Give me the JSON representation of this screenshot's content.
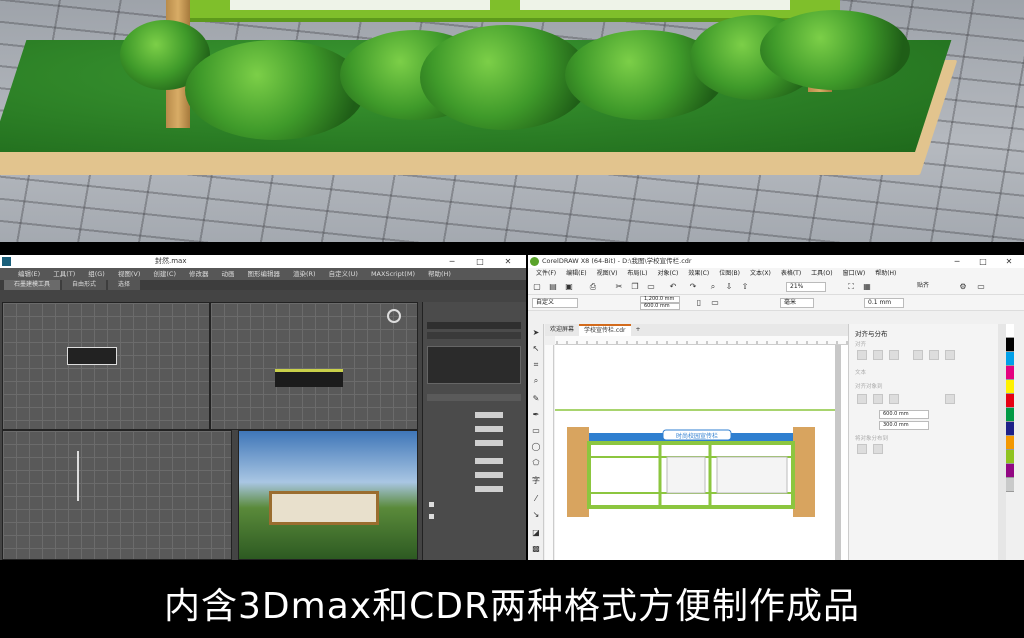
{
  "caption": "内含3Dmax和CDR两种格式方便制作成品",
  "max_window": {
    "title": "封然.max",
    "menu": [
      "编辑(E)",
      "工具(T)",
      "组(G)",
      "视图(V)",
      "创建(C)",
      "修改器",
      "动画",
      "图形编辑器",
      "渲染(R)",
      "自定义(U)",
      "MAXScript(M)",
      "帮助(H)"
    ],
    "ribbon_tabs": [
      "石墨建模工具",
      "自由形式",
      "选择"
    ],
    "controls": {
      "minimize": "─",
      "maximize": "□",
      "close": "✕"
    }
  },
  "cdr_window": {
    "title": "CorelDRAW X8 (64-Bit) - D:\\我图\\学校宣传栏.cdr",
    "menu": [
      "文件(F)",
      "编辑(E)",
      "视图(V)",
      "布局(L)",
      "对象(C)",
      "效果(C)",
      "位图(B)",
      "文本(X)",
      "表格(T)",
      "工具(O)",
      "窗口(W)",
      "帮助(H)"
    ],
    "zoom": "21%",
    "snap": "贴齐",
    "width_value": "1,200.0 mm",
    "height_value": "600.0 mm",
    "font_name": "自定义",
    "unit": "毫米",
    "nudge": "0.1 mm",
    "doc_tabs": [
      "欢迎屏幕",
      "学校宣传栏.cdr"
    ],
    "banner_text": "时尚校园宣传栏",
    "docker": {
      "title": "对齐与分布",
      "section_align": "对齐",
      "section_text": "文本",
      "section_distribute": "对齐对象到",
      "section_spacing": "将对象分布到",
      "x_value": "600.0 mm",
      "y_value": "300.0 mm"
    },
    "controls": {
      "minimize": "─",
      "maximize": "□",
      "close": "✕"
    }
  },
  "colors": {
    "accent_green": "#8cc63f",
    "post_wood": "#d8a45f",
    "banner_blue": "#2f7fd0",
    "palette": [
      "#ffffff",
      "#000000",
      "#00a0e9",
      "#e4007f",
      "#fff100",
      "#e60012",
      "#009944",
      "#1d2088",
      "#f39800",
      "#8fc31f",
      "#920783",
      "#c9caca"
    ]
  }
}
